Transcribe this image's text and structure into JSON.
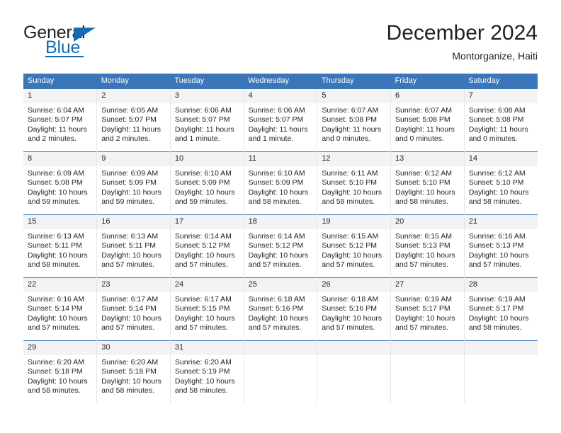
{
  "brand": {
    "name_part1": "General",
    "name_part2": "Blue",
    "logo_icon": "triangle-logo-icon"
  },
  "header": {
    "title": "December 2024",
    "subtitle": "Montorganize, Haiti"
  },
  "colors": {
    "header_blue": "#3a76b8",
    "brand_blue": "#156bb1",
    "daynum_band": "#f3f3f3",
    "cell_divider": "#e6e6e6",
    "text": "#231f20"
  },
  "weekday_headers": [
    "Sunday",
    "Monday",
    "Tuesday",
    "Wednesday",
    "Thursday",
    "Friday",
    "Saturday"
  ],
  "weeks": [
    [
      {
        "day": "1",
        "sunrise": "Sunrise: 6:04 AM",
        "sunset": "Sunset: 5:07 PM",
        "daylight_line1": "Daylight: 11 hours",
        "daylight_line2": "and 2 minutes."
      },
      {
        "day": "2",
        "sunrise": "Sunrise: 6:05 AM",
        "sunset": "Sunset: 5:07 PM",
        "daylight_line1": "Daylight: 11 hours",
        "daylight_line2": "and 2 minutes."
      },
      {
        "day": "3",
        "sunrise": "Sunrise: 6:06 AM",
        "sunset": "Sunset: 5:07 PM",
        "daylight_line1": "Daylight: 11 hours",
        "daylight_line2": "and 1 minute."
      },
      {
        "day": "4",
        "sunrise": "Sunrise: 6:06 AM",
        "sunset": "Sunset: 5:07 PM",
        "daylight_line1": "Daylight: 11 hours",
        "daylight_line2": "and 1 minute."
      },
      {
        "day": "5",
        "sunrise": "Sunrise: 6:07 AM",
        "sunset": "Sunset: 5:08 PM",
        "daylight_line1": "Daylight: 11 hours",
        "daylight_line2": "and 0 minutes."
      },
      {
        "day": "6",
        "sunrise": "Sunrise: 6:07 AM",
        "sunset": "Sunset: 5:08 PM",
        "daylight_line1": "Daylight: 11 hours",
        "daylight_line2": "and 0 minutes."
      },
      {
        "day": "7",
        "sunrise": "Sunrise: 6:08 AM",
        "sunset": "Sunset: 5:08 PM",
        "daylight_line1": "Daylight: 11 hours",
        "daylight_line2": "and 0 minutes."
      }
    ],
    [
      {
        "day": "8",
        "sunrise": "Sunrise: 6:09 AM",
        "sunset": "Sunset: 5:08 PM",
        "daylight_line1": "Daylight: 10 hours",
        "daylight_line2": "and 59 minutes."
      },
      {
        "day": "9",
        "sunrise": "Sunrise: 6:09 AM",
        "sunset": "Sunset: 5:09 PM",
        "daylight_line1": "Daylight: 10 hours",
        "daylight_line2": "and 59 minutes."
      },
      {
        "day": "10",
        "sunrise": "Sunrise: 6:10 AM",
        "sunset": "Sunset: 5:09 PM",
        "daylight_line1": "Daylight: 10 hours",
        "daylight_line2": "and 59 minutes."
      },
      {
        "day": "11",
        "sunrise": "Sunrise: 6:10 AM",
        "sunset": "Sunset: 5:09 PM",
        "daylight_line1": "Daylight: 10 hours",
        "daylight_line2": "and 58 minutes."
      },
      {
        "day": "12",
        "sunrise": "Sunrise: 6:11 AM",
        "sunset": "Sunset: 5:10 PM",
        "daylight_line1": "Daylight: 10 hours",
        "daylight_line2": "and 58 minutes."
      },
      {
        "day": "13",
        "sunrise": "Sunrise: 6:12 AM",
        "sunset": "Sunset: 5:10 PM",
        "daylight_line1": "Daylight: 10 hours",
        "daylight_line2": "and 58 minutes."
      },
      {
        "day": "14",
        "sunrise": "Sunrise: 6:12 AM",
        "sunset": "Sunset: 5:10 PM",
        "daylight_line1": "Daylight: 10 hours",
        "daylight_line2": "and 58 minutes."
      }
    ],
    [
      {
        "day": "15",
        "sunrise": "Sunrise: 6:13 AM",
        "sunset": "Sunset: 5:11 PM",
        "daylight_line1": "Daylight: 10 hours",
        "daylight_line2": "and 58 minutes."
      },
      {
        "day": "16",
        "sunrise": "Sunrise: 6:13 AM",
        "sunset": "Sunset: 5:11 PM",
        "daylight_line1": "Daylight: 10 hours",
        "daylight_line2": "and 57 minutes."
      },
      {
        "day": "17",
        "sunrise": "Sunrise: 6:14 AM",
        "sunset": "Sunset: 5:12 PM",
        "daylight_line1": "Daylight: 10 hours",
        "daylight_line2": "and 57 minutes."
      },
      {
        "day": "18",
        "sunrise": "Sunrise: 6:14 AM",
        "sunset": "Sunset: 5:12 PM",
        "daylight_line1": "Daylight: 10 hours",
        "daylight_line2": "and 57 minutes."
      },
      {
        "day": "19",
        "sunrise": "Sunrise: 6:15 AM",
        "sunset": "Sunset: 5:12 PM",
        "daylight_line1": "Daylight: 10 hours",
        "daylight_line2": "and 57 minutes."
      },
      {
        "day": "20",
        "sunrise": "Sunrise: 6:15 AM",
        "sunset": "Sunset: 5:13 PM",
        "daylight_line1": "Daylight: 10 hours",
        "daylight_line2": "and 57 minutes."
      },
      {
        "day": "21",
        "sunrise": "Sunrise: 6:16 AM",
        "sunset": "Sunset: 5:13 PM",
        "daylight_line1": "Daylight: 10 hours",
        "daylight_line2": "and 57 minutes."
      }
    ],
    [
      {
        "day": "22",
        "sunrise": "Sunrise: 6:16 AM",
        "sunset": "Sunset: 5:14 PM",
        "daylight_line1": "Daylight: 10 hours",
        "daylight_line2": "and 57 minutes."
      },
      {
        "day": "23",
        "sunrise": "Sunrise: 6:17 AM",
        "sunset": "Sunset: 5:14 PM",
        "daylight_line1": "Daylight: 10 hours",
        "daylight_line2": "and 57 minutes."
      },
      {
        "day": "24",
        "sunrise": "Sunrise: 6:17 AM",
        "sunset": "Sunset: 5:15 PM",
        "daylight_line1": "Daylight: 10 hours",
        "daylight_line2": "and 57 minutes."
      },
      {
        "day": "25",
        "sunrise": "Sunrise: 6:18 AM",
        "sunset": "Sunset: 5:16 PM",
        "daylight_line1": "Daylight: 10 hours",
        "daylight_line2": "and 57 minutes."
      },
      {
        "day": "26",
        "sunrise": "Sunrise: 6:18 AM",
        "sunset": "Sunset: 5:16 PM",
        "daylight_line1": "Daylight: 10 hours",
        "daylight_line2": "and 57 minutes."
      },
      {
        "day": "27",
        "sunrise": "Sunrise: 6:19 AM",
        "sunset": "Sunset: 5:17 PM",
        "daylight_line1": "Daylight: 10 hours",
        "daylight_line2": "and 57 minutes."
      },
      {
        "day": "28",
        "sunrise": "Sunrise: 6:19 AM",
        "sunset": "Sunset: 5:17 PM",
        "daylight_line1": "Daylight: 10 hours",
        "daylight_line2": "and 58 minutes."
      }
    ],
    [
      {
        "day": "29",
        "sunrise": "Sunrise: 6:20 AM",
        "sunset": "Sunset: 5:18 PM",
        "daylight_line1": "Daylight: 10 hours",
        "daylight_line2": "and 58 minutes."
      },
      {
        "day": "30",
        "sunrise": "Sunrise: 6:20 AM",
        "sunset": "Sunset: 5:18 PM",
        "daylight_line1": "Daylight: 10 hours",
        "daylight_line2": "and 58 minutes."
      },
      {
        "day": "31",
        "sunrise": "Sunrise: 6:20 AM",
        "sunset": "Sunset: 5:19 PM",
        "daylight_line1": "Daylight: 10 hours",
        "daylight_line2": "and 58 minutes."
      },
      {
        "day": "",
        "sunrise": "",
        "sunset": "",
        "daylight_line1": "",
        "daylight_line2": ""
      },
      {
        "day": "",
        "sunrise": "",
        "sunset": "",
        "daylight_line1": "",
        "daylight_line2": ""
      },
      {
        "day": "",
        "sunrise": "",
        "sunset": "",
        "daylight_line1": "",
        "daylight_line2": ""
      },
      {
        "day": "",
        "sunrise": "",
        "sunset": "",
        "daylight_line1": "",
        "daylight_line2": ""
      }
    ]
  ]
}
